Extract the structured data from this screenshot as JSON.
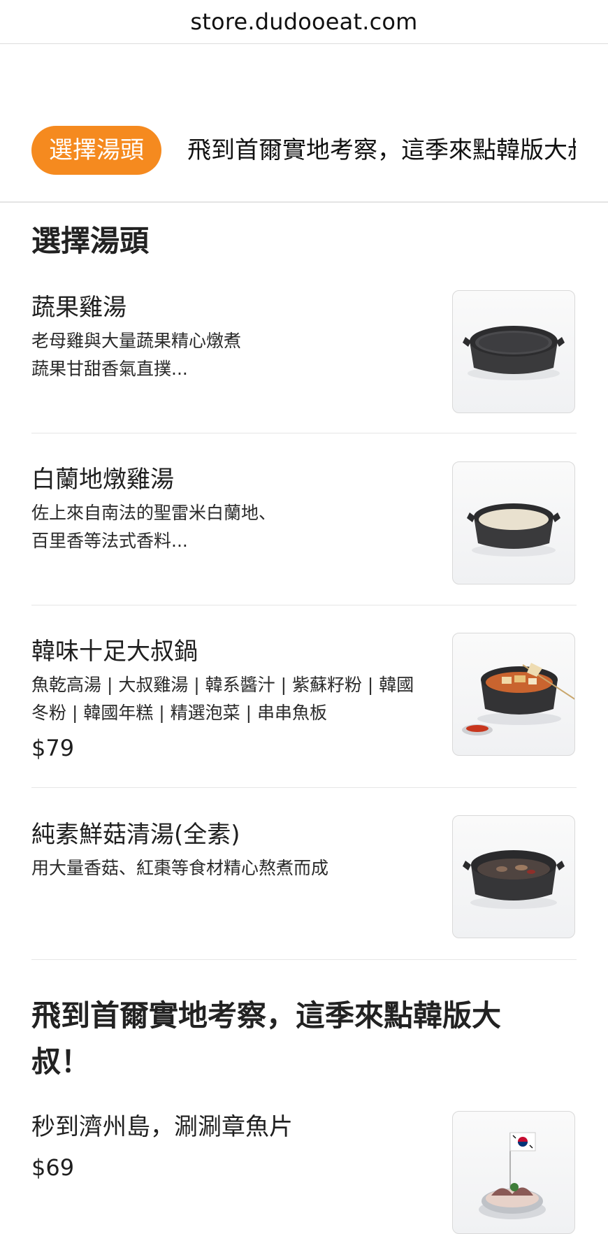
{
  "browser": {
    "url": "store.dudooeat.com"
  },
  "tabs": [
    {
      "label": "選擇湯頭",
      "active": true
    },
    {
      "label": "飛到首爾實地考察，這季來點韓版大叔！",
      "active": false
    }
  ],
  "sections": [
    {
      "title": "選擇湯頭",
      "items": [
        {
          "name": "蔬果雞湯",
          "description": "老母雞與大量蔬果精心燉煮\n蔬果甘甜香氣直撲...",
          "price": "",
          "image": "pot-clear-broth"
        },
        {
          "name": "白蘭地燉雞湯",
          "description": "佐上來自南法的聖雷米白蘭地、\n百里香等法式香料...",
          "price": "",
          "image": "pot-white-broth"
        },
        {
          "name": "韓味十足大叔鍋",
          "description": "魚乾高湯 | 大叔雞湯 | 韓系醬汁 | 紫蘇籽粉 | 韓國\n冬粉  | 韓國年糕 | 精選泡菜 | 串串魚板",
          "price": "$79",
          "image": "pot-korean-stew"
        },
        {
          "name": "純素鮮菇清湯(全素)",
          "description": "用大量香菇、紅棗等食材精心熬煮而成",
          "price": "",
          "image": "pot-mushroom-broth"
        }
      ]
    },
    {
      "title": "飛到首爾實地考察，這季來點韓版大叔！",
      "items": [
        {
          "name": "秒到濟州島，涮涮章魚片",
          "description": "",
          "price": "$69",
          "image": "octopus-plate-with-flag"
        }
      ]
    }
  ],
  "colors": {
    "accent": "#f58a1f",
    "divider": "#e6e6e6",
    "text": "#1f1f1f"
  }
}
